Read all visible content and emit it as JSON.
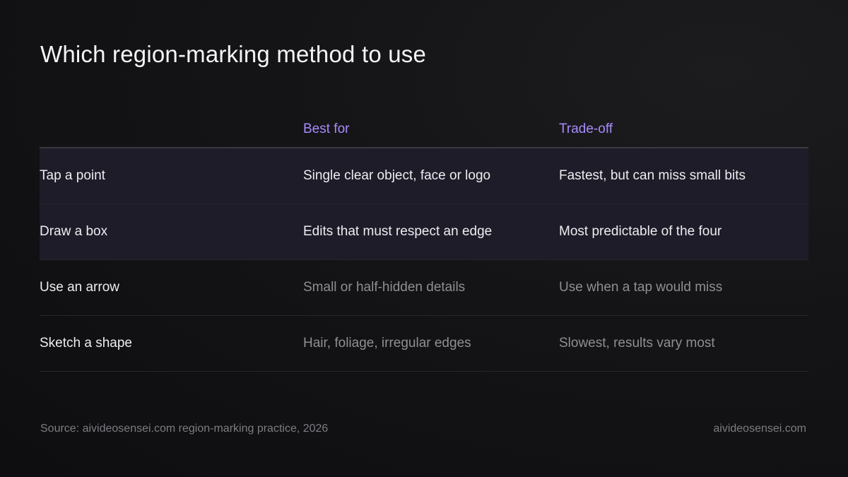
{
  "title": "Which region-marking method to use",
  "columns": [
    "",
    "Best for",
    "Trade-off"
  ],
  "rows": [
    {
      "method": "Tap a point",
      "best_for": "Single clear object, face or logo",
      "trade_off": "Fastest, but can miss small bits",
      "highlighted": true
    },
    {
      "method": "Draw a box",
      "best_for": "Edits that must respect an edge",
      "trade_off": "Most predictable of the four",
      "highlighted": true
    },
    {
      "method": "Use an arrow",
      "best_for": "Small or half-hidden details",
      "trade_off": "Use when a tap would miss",
      "highlighted": false
    },
    {
      "method": "Sketch a shape",
      "best_for": "Hair, foliage, irregular edges",
      "trade_off": "Slowest, results vary most",
      "highlighted": false
    }
  ],
  "footer": {
    "source": "Source: aivideosensei.com region-marking practice, 2026",
    "brand": "aivideosensei.com"
  },
  "colors": {
    "accent": "#a78bfa",
    "highlight_row": "#1e1c29",
    "background": "#141416"
  }
}
